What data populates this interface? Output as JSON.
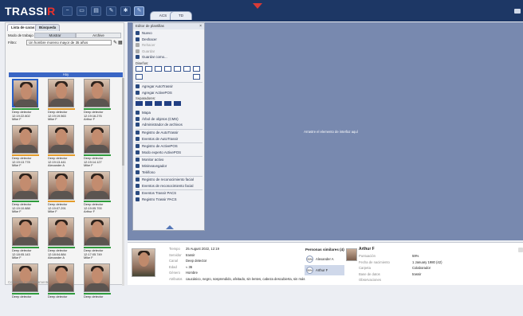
{
  "app": {
    "logo_main": "TRASSI",
    "logo_red": "R"
  },
  "top_tabs": [
    "ACS",
    "TD"
  ],
  "left_panel": {
    "tabs": [
      "Lista de caras",
      "Búsqueda"
    ],
    "mode_label": "Modo de trabajo",
    "mode_options": [
      "Mostrar",
      "Archive"
    ],
    "filter_label": "Filtro:",
    "filter_value": "Un hombre moreno mayor de 35 años",
    "column_header": "Hoy",
    "footer": "Contactar inmediatamente",
    "cards": [
      {
        "line1": "Deep detector",
        "line2": "12:19:22.802",
        "line3": "Mike F",
        "color": "#2e9b3c",
        "selected": true
      },
      {
        "line1": "Deep detector",
        "line2": "12:19:19.563",
        "line3": "Mike F",
        "color": "#e39b29",
        "selected": false
      },
      {
        "line1": "Deep detector",
        "line2": "12:19:16.276",
        "line3": "Arthur F",
        "color": "#2e9b3c",
        "selected": false
      },
      {
        "line1": "Deep detector",
        "line2": "12:19:13.778",
        "line3": "Mike F",
        "color": "#e39b29",
        "selected": false
      },
      {
        "line1": "Deep detector",
        "line2": "12:19:13.441",
        "line3": "Alexander A",
        "color": "#e39b29",
        "selected": false
      },
      {
        "line1": "Deep detector",
        "line2": "12:19:14.127",
        "line3": "Mike F",
        "color": "#2e9b3c",
        "selected": false
      },
      {
        "line1": "Deep detector",
        "line2": "12:19:10.888",
        "line3": "Mike F",
        "color": "#2e9b3c",
        "selected": false
      },
      {
        "line1": "Deep detector",
        "line2": "12:19:07.291",
        "line3": "Mike F",
        "color": "#e39b29",
        "selected": false
      },
      {
        "line1": "Deep detector",
        "line2": "12:19:05.700",
        "line3": "Arthur F",
        "color": "#2e9b3c",
        "selected": false
      },
      {
        "line1": "Deep detector",
        "line2": "12:18:05.143",
        "line3": "Mike F",
        "color": "#2e9b3c",
        "selected": false
      },
      {
        "line1": "Deep detector",
        "line2": "12:18:04.884",
        "line3": "Alexander A",
        "color": "#2e9b3c",
        "selected": false
      },
      {
        "line1": "Deep detector",
        "line2": "12:17:05.749",
        "line3": "Mike F",
        "color": "#2e9b3c",
        "selected": false
      },
      {
        "line1": "Deep detector",
        "line2": "",
        "line3": "",
        "color": "#2e9b3c",
        "selected": false
      },
      {
        "line1": "Deep detector",
        "line2": "",
        "line3": "",
        "color": "#2e9b3c",
        "selected": false
      },
      {
        "line1": "Deep detector",
        "line2": "",
        "line3": "",
        "color": "#2e9b3c",
        "selected": false
      }
    ]
  },
  "template_panel": {
    "title": "Editor de plantillas",
    "close": "×",
    "items_top": [
      {
        "label": "Nuevo",
        "icon": "new-icon",
        "dim": false
      },
      {
        "label": "Deshacer",
        "icon": "undo-icon",
        "dim": false
      },
      {
        "label": "Rehacer",
        "icon": "redo-icon",
        "dim": true
      },
      {
        "label": "Guardar",
        "icon": "save-icon",
        "dim": true
      },
      {
        "label": "Guardar como...",
        "icon": "save-as-icon",
        "dim": false
      }
    ],
    "layouts_label": "Diseños:",
    "add_items": [
      {
        "label": "Agregar AutoTrassir",
        "icon": "plus-icon"
      },
      {
        "label": "Agregar ActivePOS",
        "icon": "plus-icon"
      }
    ],
    "separators_label": "Separadores:",
    "items_bottom": [
      {
        "label": "Mapa",
        "icon": "map-icon"
      },
      {
        "label": "Árbol de objetos (CMS)",
        "icon": "tree-icon"
      },
      {
        "label": "Administrador de archivos",
        "icon": "folder-icon"
      },
      {
        "label": "Registro de AutoTrassir",
        "icon": "log-icon"
      },
      {
        "label": "Eventos de AutoTrassir",
        "icon": "events-icon"
      },
      {
        "label": "Registro de ActivePOS",
        "icon": "log-icon"
      },
      {
        "label": "Modo experto ActivePOS",
        "icon": "expert-icon"
      },
      {
        "label": "Monitor activo",
        "icon": "monitor-icon"
      },
      {
        "label": "Minineavegador",
        "icon": "browser-icon"
      },
      {
        "label": "Teléfono",
        "icon": "phone-icon"
      },
      {
        "label": "Registro de reconocimiento facial",
        "icon": "face-log-icon"
      },
      {
        "label": "Eventos de reconocimiento facial",
        "icon": "face-events-icon"
      },
      {
        "label": "Eventos Trassir PACS",
        "icon": "pacs-events-icon"
      },
      {
        "label": "Registro Trassir PACS",
        "icon": "pacs-log-icon"
      }
    ]
  },
  "canvas": {
    "message": "Arrastre el elemento de interfaz aquí"
  },
  "details": {
    "rows": [
      {
        "label": "Tiempo",
        "value": "25 August 2022, 12:19"
      },
      {
        "label": "Servidor",
        "value": "trassir"
      },
      {
        "label": "Canal",
        "value": "Deep detector"
      },
      {
        "label": "Edad",
        "value": "≈ 36"
      },
      {
        "label": "Género",
        "value": "Hombre"
      },
      {
        "label": "Atributos",
        "value": "caucásico, negro, sosprendido, afeitado, sin lentes, cabeza descubierta, sin más"
      }
    ]
  },
  "similar": {
    "title": "Personas similares (4)",
    "items": [
      {
        "pct": "33%",
        "name": "Alexander A",
        "selected": false
      },
      {
        "pct": "59%",
        "name": "Arthur F",
        "selected": true
      }
    ]
  },
  "person": {
    "name": "Arthur F",
    "rows": [
      {
        "label": "Puntuación",
        "value": "59%"
      },
      {
        "label": "Fecha de nacimiento",
        "value": "1 January 1980 (42)"
      },
      {
        "label": "Carpeta",
        "value": "Colaborador"
      },
      {
        "label": "Base de datos",
        "value": "trassir"
      },
      {
        "label": "Observaciones",
        "value": ""
      }
    ]
  }
}
